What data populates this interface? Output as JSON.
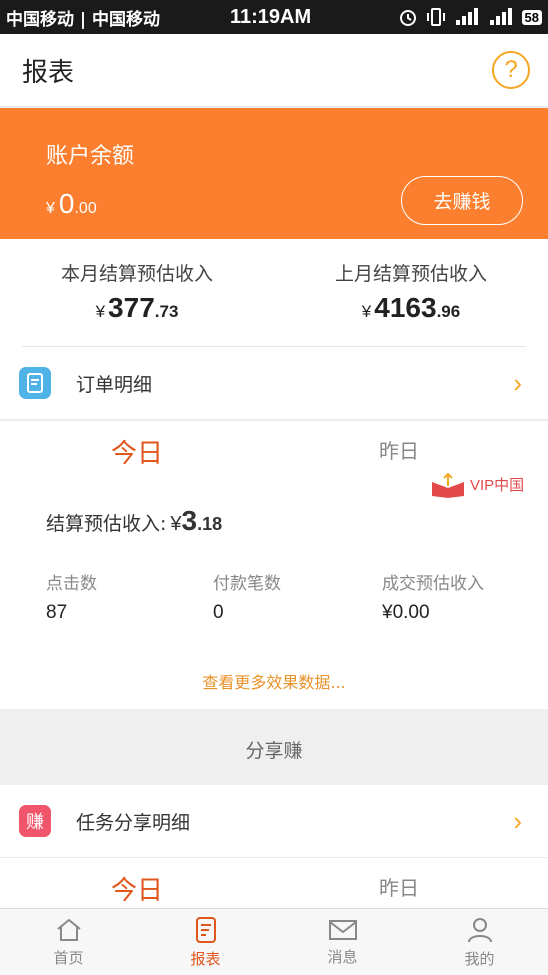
{
  "status_bar": {
    "carrier": "中国移动 | 中国移动",
    "time": "11:19AM",
    "battery": "58"
  },
  "header": {
    "title": "报表"
  },
  "balance": {
    "label": "账户余额",
    "currency": "¥",
    "integer": "0",
    "decimal": ".00",
    "earn_button": "去赚钱"
  },
  "stats": {
    "this_month": {
      "label": "本月结算预估收入",
      "currency": "¥",
      "integer": "377",
      "decimal": ".73"
    },
    "last_month": {
      "label": "上月结算预估收入",
      "currency": "¥",
      "integer": "4163",
      "decimal": ".96"
    }
  },
  "order_row": {
    "label": "订单明细",
    "chevron": "›"
  },
  "report_panel": {
    "tabs": [
      "今日",
      "昨日"
    ],
    "settle_label": "结算预估收入:",
    "settle_currency": "¥",
    "settle_integer": "3",
    "settle_decimal": ".18",
    "metrics": [
      {
        "label": "点击数",
        "value": "87"
      },
      {
        "label": "付款笔数",
        "value": "0"
      },
      {
        "label": "成交预估收入",
        "value": "¥0.00"
      }
    ],
    "more_link": "查看更多效果数据..."
  },
  "watermark": "VIP中国",
  "share_section": {
    "title": "分享赚"
  },
  "task_row": {
    "label": "任务分享明细",
    "chevron": "›"
  },
  "task_panel": {
    "tabs": [
      "今日",
      "昨日"
    ]
  },
  "tabbar": {
    "items": [
      {
        "label": "首页",
        "icon": "home-icon"
      },
      {
        "label": "报表",
        "icon": "report-icon"
      },
      {
        "label": "消息",
        "icon": "mail-icon"
      },
      {
        "label": "我的",
        "icon": "user-icon"
      }
    ]
  },
  "colors": {
    "accent": "#fb7f2e",
    "active_tab": "#e0561b",
    "link": "#e8932b"
  }
}
